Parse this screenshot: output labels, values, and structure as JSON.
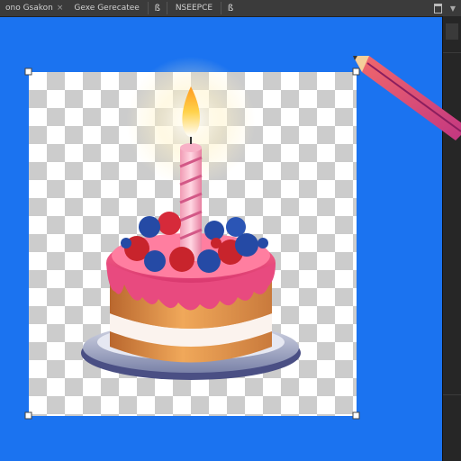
{
  "tabs": [
    {
      "label": "ono Gsakon"
    },
    {
      "label": "Gexe Gerecatee"
    }
  ],
  "tab_close_glyph": "×",
  "toolbar": {
    "tool_glyph": "ß",
    "tool_label": "NSЕЕРСЕ",
    "tool2_glyph": "ß"
  },
  "icons": [
    "layout-icon",
    "chevron-down-icon",
    "pencil-icon",
    "birthday-cake-illustration"
  ],
  "colors": {
    "canvas_background": "#1b73f0",
    "chrome": "#3b3b3b",
    "panel": "#262626"
  }
}
